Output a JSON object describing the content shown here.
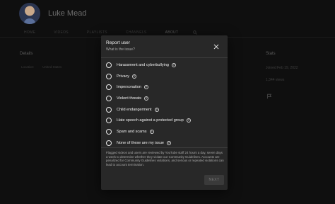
{
  "channel": {
    "name": "Luke Mead",
    "tabs": [
      {
        "label": "HOME"
      },
      {
        "label": "VIDEOS"
      },
      {
        "label": "PLAYLISTS"
      },
      {
        "label": "CHANNELS"
      },
      {
        "label": "ABOUT",
        "active": true
      }
    ],
    "details_heading": "Details",
    "details_location_label": "Location:",
    "details_location_value": "United States",
    "stats_heading": "Stats",
    "joined": "Joined Feb 19, 2022",
    "views": "1,344 views"
  },
  "dialog": {
    "title": "Report user",
    "subtitle": "What is the issue?",
    "options": [
      {
        "label": "Harassment and cyberbullying"
      },
      {
        "label": "Privacy"
      },
      {
        "label": "Impersonation"
      },
      {
        "label": "Violent threats"
      },
      {
        "label": "Child endangerment"
      },
      {
        "label": "Hate speech against a protected group"
      },
      {
        "label": "Spam and scams"
      },
      {
        "label": "None of these are my issue"
      }
    ],
    "disclaimer": "Flagged videos and users are reviewed by YouTube staff 24 hours a day, seven days a week to determine whether they violate our Community Guidelines. Accounts are penalized for Community Guidelines violations, and serious or repeated violations can lead to account termination.",
    "next_label": "NEXT"
  },
  "icons": {
    "close": "close-icon",
    "help": "help-circle-icon",
    "flag": "flag-icon",
    "search": "search-icon"
  },
  "colors": {
    "page_background": "#0f0f0f",
    "dialog_background": "#282828",
    "text_primary": "#f1f1f1",
    "text_secondary": "#aaaaaa",
    "button_disabled": "#3a3a3a"
  }
}
